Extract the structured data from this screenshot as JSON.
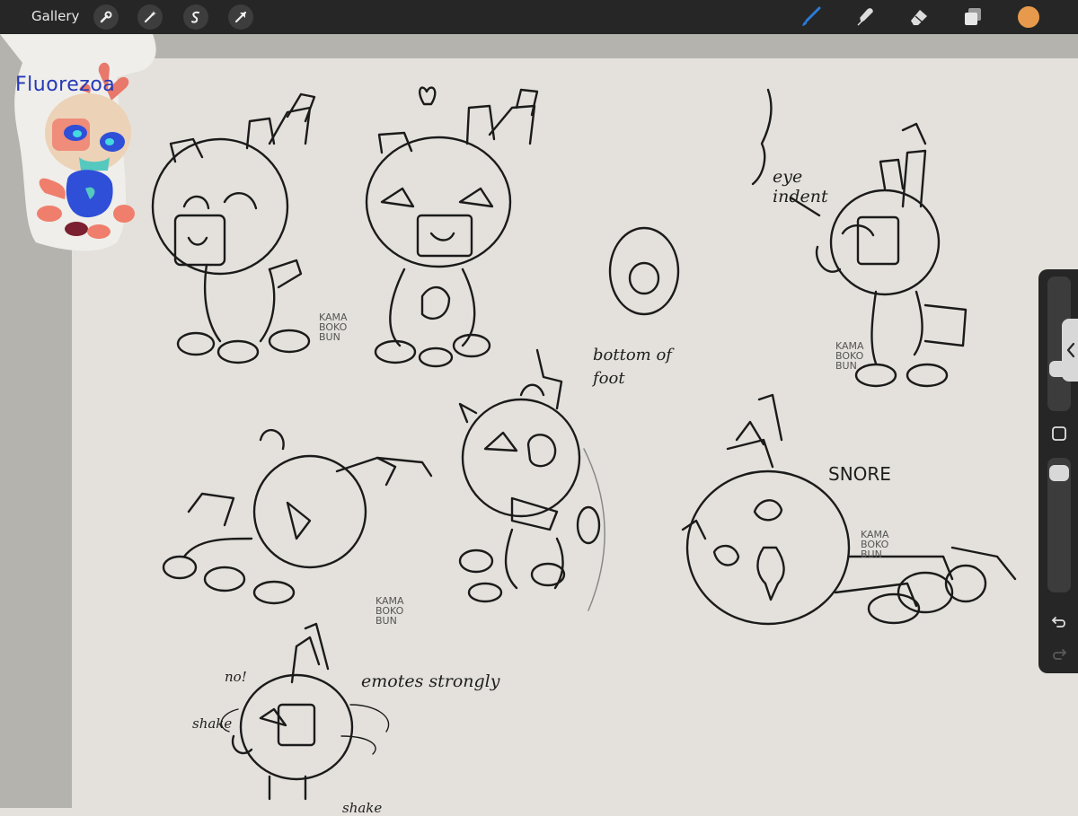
{
  "app": {
    "gallery_label": "Gallery"
  },
  "toolbar": {
    "left_tools": [
      "wrench-icon",
      "magic-wand-icon",
      "selection-icon",
      "transform-arrow-icon"
    ],
    "right_tools": [
      "brush-icon",
      "smudge-icon",
      "eraser-icon",
      "layers-icon"
    ],
    "active_tool": "brush-icon",
    "accent_color": "#2a7bd8",
    "current_color": "#e79a4c"
  },
  "sidebar": {
    "collapse_icon": "chevron-left-icon",
    "modify_icon": "square-icon",
    "undo_icon": "undo-icon",
    "redo_icon": "redo-icon",
    "brush_size_level": 0.28,
    "brush_opacity_level": 0.95
  },
  "canvas": {
    "title": "Fluorezoa",
    "title_color": "#2438b8",
    "notes": {
      "eye_indent": "eye indent",
      "bottom_of_foot": "bottom of foot",
      "snore": "SNORE",
      "emotes_strongly": "emotes strongly",
      "no": "no!",
      "shake_1": "shake",
      "shake_2": "shake"
    },
    "labels": {
      "kama_1": "KAMA BOKO BUN",
      "kama_2": "KAMA BOKO BUN",
      "kama_3": "KAMA BOKO BUN",
      "kama_4": "KAMA BOKO BUN"
    }
  }
}
